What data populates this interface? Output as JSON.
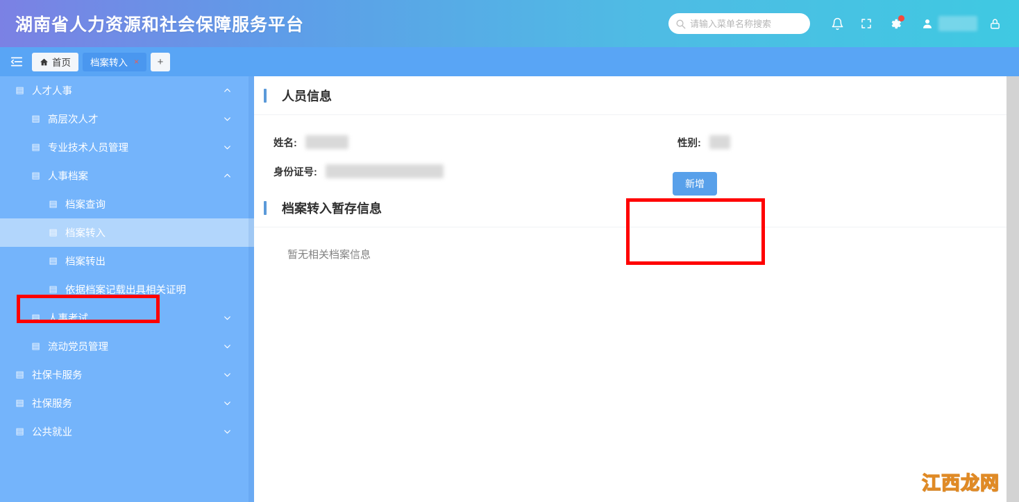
{
  "header": {
    "title": "湖南省人力资源和社会保障服务平台",
    "search": {
      "placeholder": "请输入菜单名称搜索",
      "value": ""
    },
    "icons": {
      "search": "search-icon",
      "bell": "bell-icon",
      "fullscreen": "fullscreen-icon",
      "gear": "gear-icon",
      "user": "user-icon",
      "lock": "lock-icon"
    },
    "gear_badge": true,
    "user_name": ""
  },
  "tabbar": {
    "collapse_label": "",
    "tabs": [
      {
        "label": "首页",
        "icon": "home-icon",
        "active": false,
        "closable": false
      },
      {
        "label": "档案转入",
        "icon": "",
        "active": true,
        "closable": true,
        "close_label": "×"
      }
    ],
    "add_label": "+"
  },
  "sidebar": {
    "items": [
      {
        "label": "人才人事",
        "level": 1,
        "chevron": "up",
        "active": false
      },
      {
        "label": "高层次人才",
        "level": 2,
        "chevron": "down",
        "active": false
      },
      {
        "label": "专业技术人员管理",
        "level": 2,
        "chevron": "down",
        "active": false
      },
      {
        "label": "人事档案",
        "level": 2,
        "chevron": "up",
        "active": false
      },
      {
        "label": "档案查询",
        "level": 3,
        "chevron": "none",
        "active": false
      },
      {
        "label": "档案转入",
        "level": 3,
        "chevron": "none",
        "active": true
      },
      {
        "label": "档案转出",
        "level": 3,
        "chevron": "none",
        "active": false
      },
      {
        "label": "依据档案记载出具相关证明",
        "level": 3,
        "chevron": "none",
        "active": false
      },
      {
        "label": "人事考试",
        "level": 2,
        "chevron": "down",
        "active": false
      },
      {
        "label": "流动党员管理",
        "level": 2,
        "chevron": "down",
        "active": false
      },
      {
        "label": "社保卡服务",
        "level": 1,
        "chevron": "down",
        "active": false
      },
      {
        "label": "社保服务",
        "level": 1,
        "chevron": "down",
        "active": false
      },
      {
        "label": "公共就业",
        "level": 1,
        "chevron": "down",
        "active": false
      }
    ],
    "item_icon": "▤"
  },
  "main": {
    "person_section": {
      "title": "人员信息",
      "fields": {
        "name_label": "姓名:",
        "name_value": "",
        "gender_label": "性别:",
        "gender_value": "",
        "idcard_label": "身份证号:",
        "idcard_value": ""
      },
      "add_button": "新增"
    },
    "transfer_section": {
      "title": "档案转入暂存信息",
      "empty_text": "暂无相关档案信息"
    }
  },
  "watermark": {
    "text": "江西龙网"
  },
  "colors": {
    "header_gradient_start": "#7b81e4",
    "header_gradient_end": "#3fc9e2",
    "tabbar_bg": "#59a5f5",
    "sidebar_bg": "#74b4fb",
    "sidebar_active_bg": "#b2d6fc",
    "accent_bar": "#5b9ad9",
    "primary_button": "#58a0ea",
    "highlight_outline": "#ff0000",
    "badge_red": "#f5493d"
  }
}
